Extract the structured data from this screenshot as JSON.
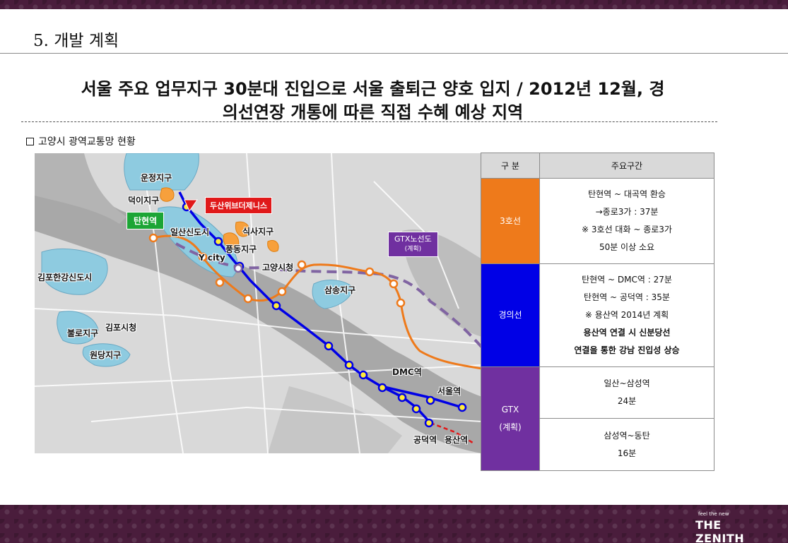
{
  "section_title": "5. 개발 계획",
  "headline": {
    "line1": "서울 주요 업무지구 30분대 진입으로 서울 출퇴근 양호 입지 / 2012년 12월, 경",
    "line2": "의선연장 개통에 따른 직접 수혜 예상 지역"
  },
  "subheading": "고양시 광역교통망 현황",
  "map": {
    "labels": {
      "unjeong": "운정지구",
      "deogi": "덕이지구",
      "doosan": "두산위브더제니스",
      "tanhyeon": "탄현역",
      "ilsan": "일산신도시",
      "siksa": "식사지구",
      "pungdong": "풍동지구",
      "ycity": "Y city",
      "goyang": "고양시청",
      "samsong": "삼송지구",
      "gtx_line": "GTX노선도",
      "gtx_plan": "(계획)",
      "gimpo_new": "김포한강신도시",
      "gimpo_city": "김포시청",
      "bullo": "불로지구",
      "wondang": "원당지구",
      "dmc": "DMC역",
      "seoul": "서울역",
      "gongdeok": "공덕역",
      "yongsan": "용산역"
    },
    "colors": {
      "line3": "#ee7a1b",
      "gyeongui": "#0000e6",
      "gtx": "#8064a2",
      "district": "#8ecbe0",
      "development": "#f7a03c"
    }
  },
  "table": {
    "headers": [
      "구 분",
      "주요구간"
    ],
    "rows": [
      {
        "category": "3호선",
        "color": "#ee7a1b",
        "lines": [
          "탄현역 ~ 대곡역 환승",
          "→종로3가 : 37분",
          "※ 3호선 대화 ~ 종로3가",
          "50분 이상 소요"
        ]
      },
      {
        "category": "경의선",
        "color": "#0000e6",
        "lines": [
          "탄현역 ~ DMC역 : 27분",
          "탄현역 ~ 공덕역 : 35분",
          "※ 용산역 2014년 계획",
          "용산역 연결 시 신분당선",
          "연결을 통한 강남 진입성 상승"
        ]
      },
      {
        "category_line1": "GTX",
        "category_line2": "(계획)",
        "color": "#7030a0",
        "sub1": [
          "일산~삼성역",
          "24분"
        ],
        "sub2": [
          "삼성역~동탄",
          "16분"
        ]
      }
    ]
  },
  "logo": {
    "small": "feel the new",
    "brand": "THE ZENITH"
  }
}
